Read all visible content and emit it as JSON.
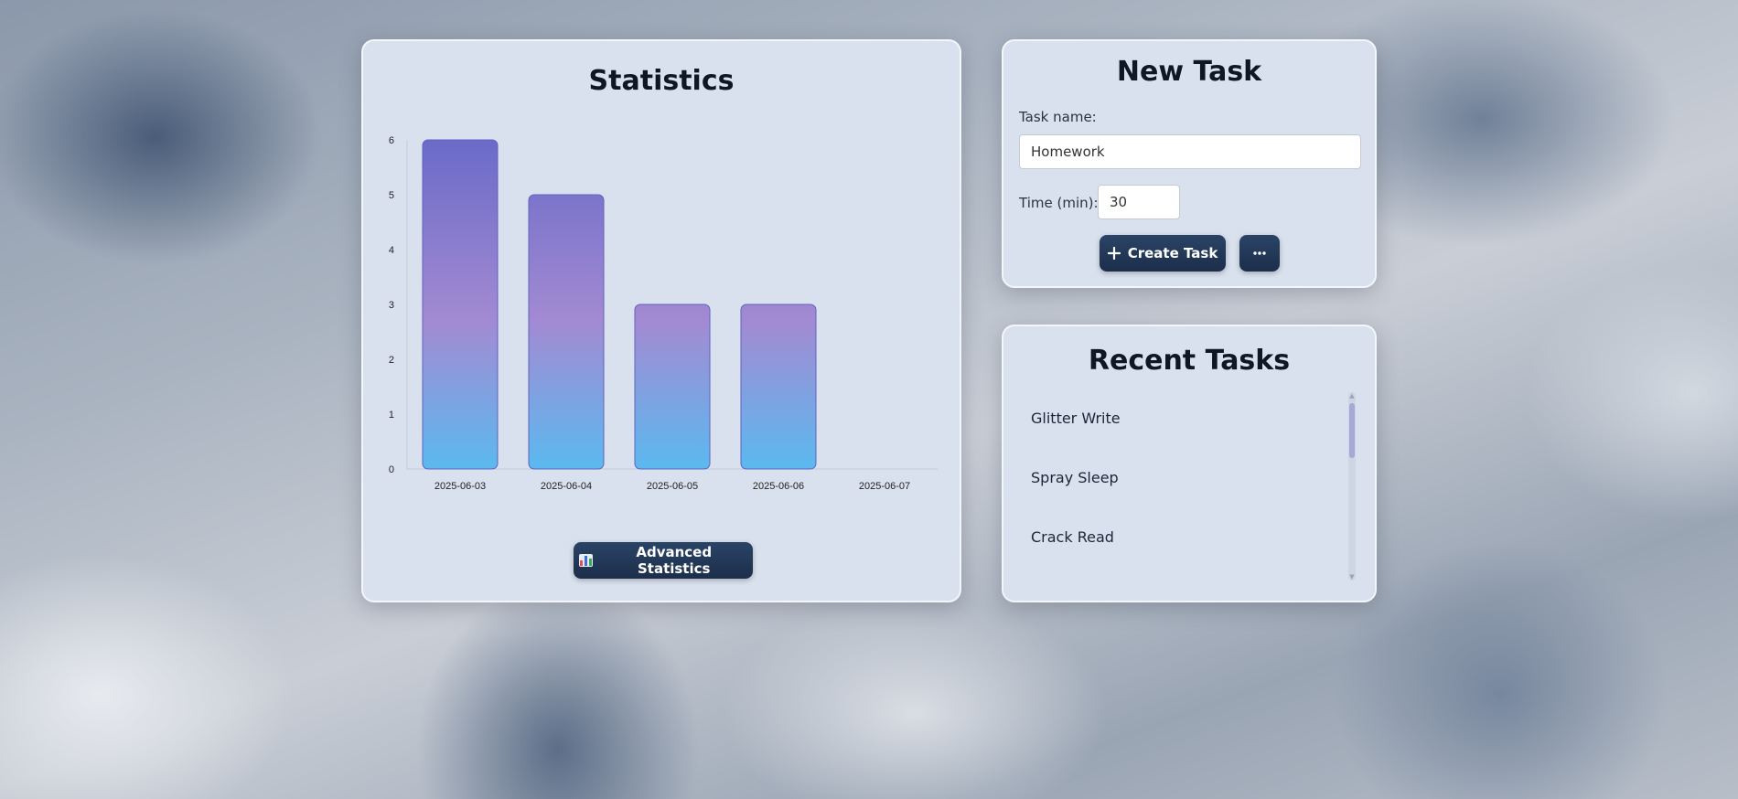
{
  "statistics": {
    "title": "Statistics",
    "advanced_button": "Advanced Statistics",
    "advanced_icon": "bar-chart-icon"
  },
  "chart_data": {
    "type": "bar",
    "title": "",
    "xlabel": "",
    "ylabel": "",
    "categories": [
      "2025-06-03",
      "2025-06-04",
      "2025-06-05",
      "2025-06-06",
      "2025-06-07"
    ],
    "values": [
      6,
      5,
      3,
      3,
      0
    ],
    "ylim": [
      0,
      6
    ],
    "yticks": [
      "0",
      "1",
      "2",
      "3",
      "4",
      "5",
      "6"
    ],
    "grid": false,
    "legend": "none",
    "bar_gradient": [
      "#6a6bc8",
      "#a38ad2",
      "#5bb9ef"
    ]
  },
  "new_task": {
    "title": "New Task",
    "task_name_label": "Task name:",
    "task_name_value": "Homework",
    "time_label": "Time (min):",
    "time_value": "30",
    "create_button": "Create Task",
    "create_icon": "plus-icon",
    "more_icon": "more-options-icon"
  },
  "recent_tasks": {
    "title": "Recent Tasks",
    "items": [
      "Glitter Write",
      "Spray Sleep",
      "Crack Read"
    ]
  },
  "colors": {
    "card_bg": "#d9e1ee",
    "button_dark": "#1c2e4a"
  }
}
